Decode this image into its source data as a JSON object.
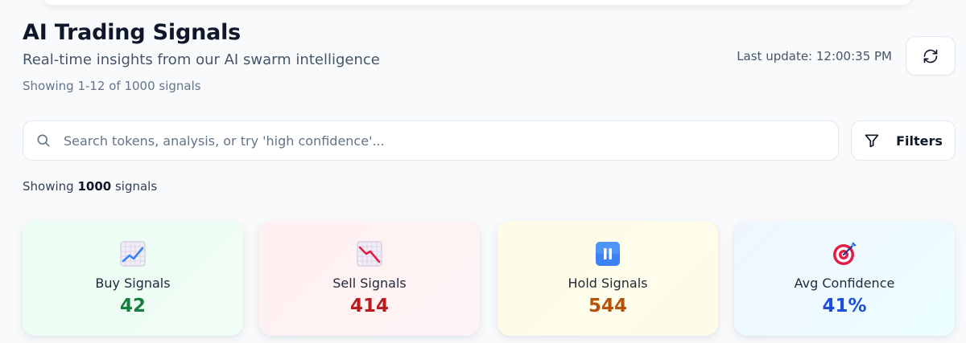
{
  "header": {
    "title": "AI Trading Signals",
    "subtitle": "Real-time insights from our AI swarm intelligence",
    "range_text": "Showing 1-12 of 1000 signals"
  },
  "status": {
    "last_update": "Last update: 12:00:35 PM",
    "refresh_icon": "refresh-icon"
  },
  "search": {
    "value": "",
    "placeholder": "Search tokens, analysis, or try 'high confidence'...",
    "icon": "search-icon"
  },
  "filters": {
    "label": "Filters",
    "icon": "filter-icon"
  },
  "results": {
    "prefix": "Showing",
    "count": "1000",
    "suffix": "signals"
  },
  "stats": [
    {
      "label": "Buy Signals",
      "value": "42",
      "icon": "chart-increasing-icon",
      "color": "#15803d"
    },
    {
      "label": "Sell Signals",
      "value": "414",
      "icon": "chart-decreasing-icon",
      "color": "#b91c1c"
    },
    {
      "label": "Hold Signals",
      "value": "544",
      "icon": "pause-icon",
      "color": "#b45309"
    },
    {
      "label": "Avg Confidence",
      "value": "41%",
      "icon": "target-icon",
      "color": "#1d4ed8"
    }
  ]
}
